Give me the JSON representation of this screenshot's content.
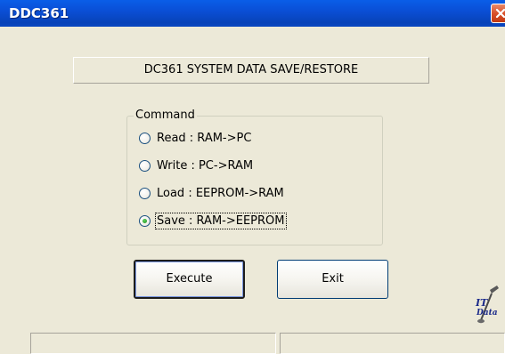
{
  "window": {
    "title": "DDC361"
  },
  "header": {
    "text": "DC361 SYSTEM DATA SAVE/RESTORE"
  },
  "command_group": {
    "legend": "Command",
    "options": [
      {
        "label": "Read : RAM->PC",
        "checked": false
      },
      {
        "label": "Write : PC->RAM",
        "checked": false
      },
      {
        "label": "Load :  EEPROM->RAM",
        "checked": false
      },
      {
        "label": "Save :  RAM->EEPROM",
        "checked": true
      }
    ]
  },
  "buttons": {
    "execute": "Execute",
    "exit": "Exit"
  },
  "statusbar": {
    "panel1": "",
    "panel2": ""
  },
  "icons": {
    "close": "close-icon",
    "logo": "datalogger-logo-icon"
  },
  "colors": {
    "titlebar": "#0a4fd6",
    "face": "#ece9d8",
    "close": "#d9502a"
  }
}
